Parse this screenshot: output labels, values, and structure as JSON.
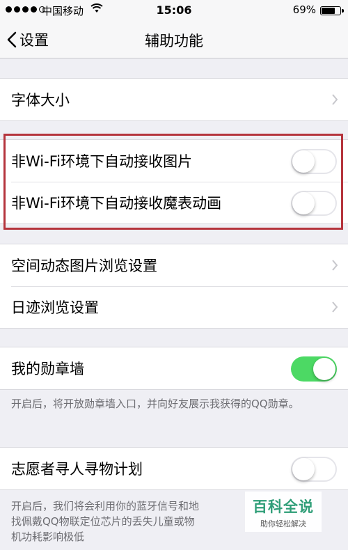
{
  "status_bar": {
    "carrier": "中国移动",
    "time": "15:06",
    "battery": "69%"
  },
  "nav": {
    "back_label": "设置",
    "title": "辅助功能"
  },
  "group1": {
    "font_size": "字体大小"
  },
  "group2": {
    "auto_receive_images": {
      "label": "非Wi-Fi环境下自动接收图片",
      "on": false
    },
    "auto_receive_magic": {
      "label": "非Wi-Fi环境下自动接收魔表动画",
      "on": false
    }
  },
  "group3": {
    "space_browse": "空间动态图片浏览设置",
    "trace_browse": "日迹浏览设置"
  },
  "group4": {
    "badge_wall": {
      "label": "我的勋章墙",
      "on": true
    },
    "footer": "开启后，将开放勋章墙入口，并向好友展示我获得的QQ勋章。"
  },
  "group5": {
    "volunteer": {
      "label": "志愿者寻人寻物计划",
      "on": false
    },
    "footer_line1": "开启后，我们将会利用你的蓝牙信号和地",
    "footer_line2": "找佩戴QQ物联定位芯片的丢失儿童或物",
    "footer_line3": "机功耗影响极低"
  },
  "watermark": {
    "title": "百科全说",
    "subtitle": "助你轻松解决"
  }
}
